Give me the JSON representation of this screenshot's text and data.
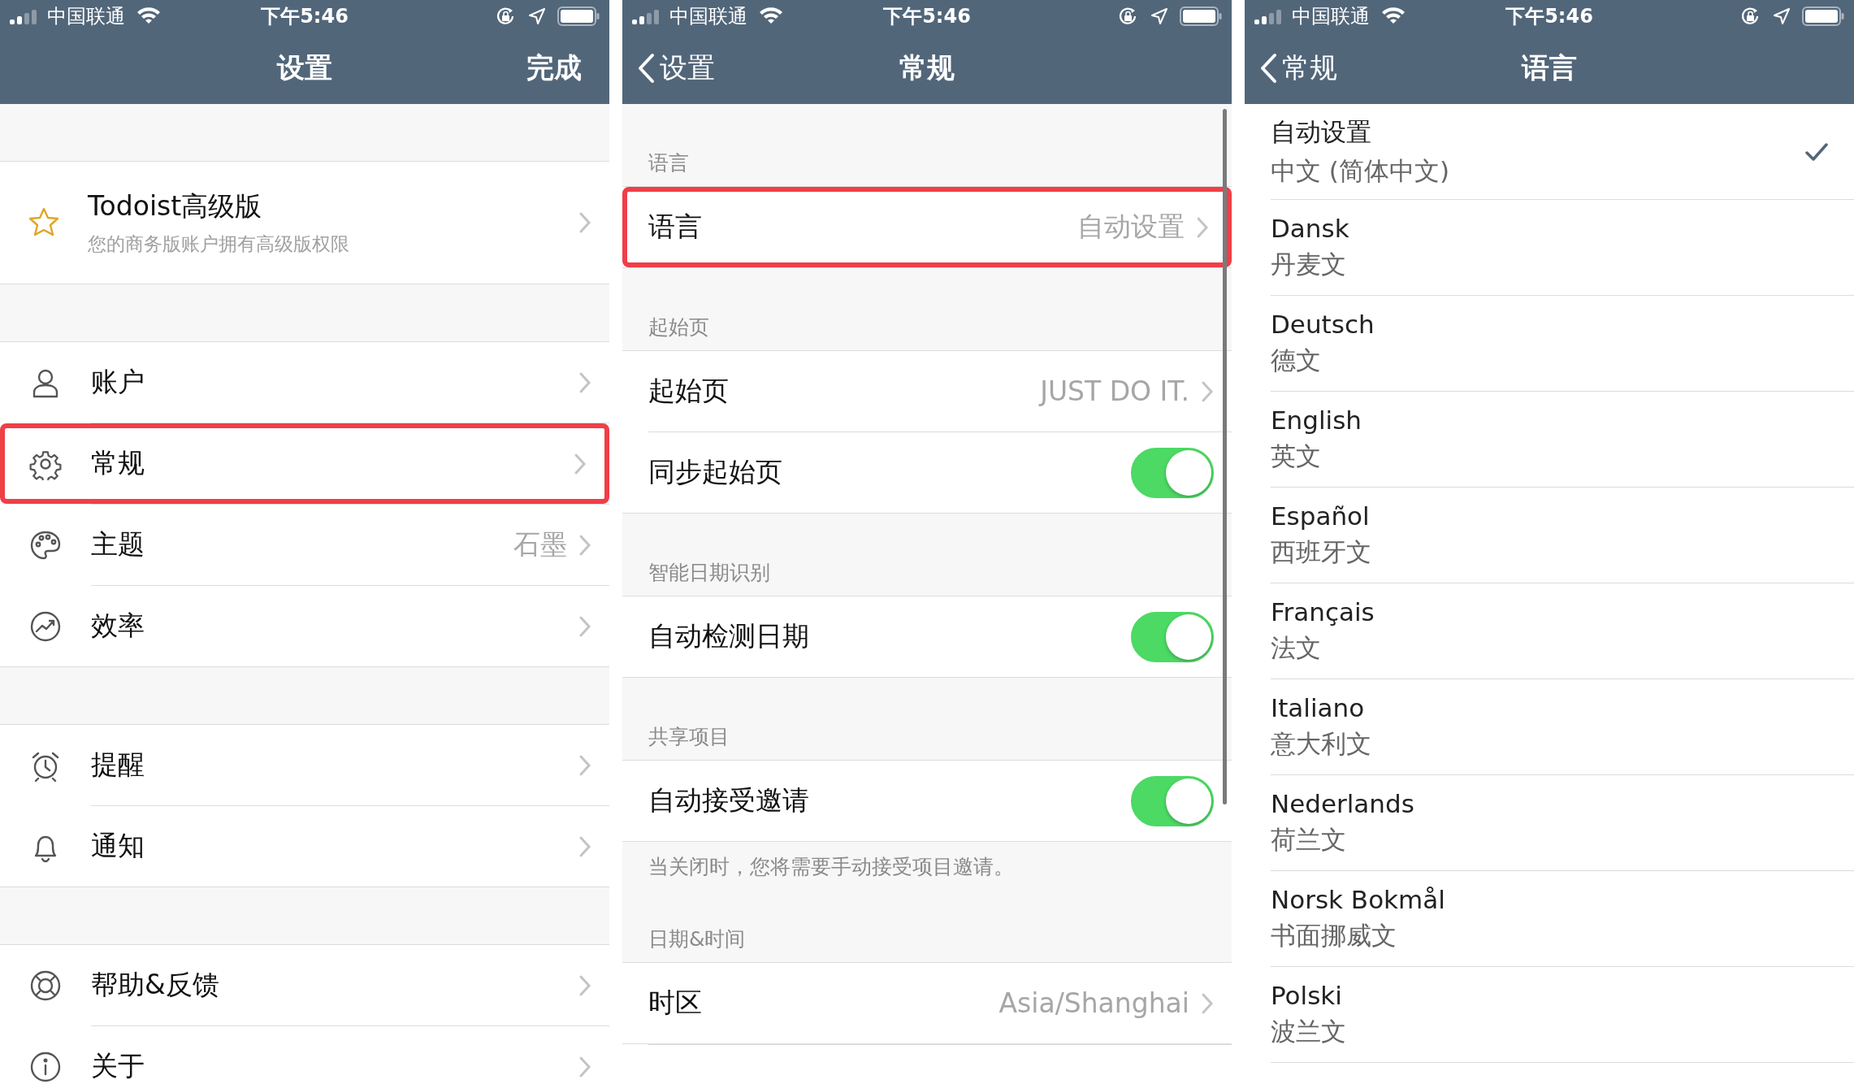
{
  "screens": [
    {
      "kind": "settings",
      "status_bar": {
        "carrier": "中国联通",
        "time": "下午5:46"
      },
      "nav": {
        "title": "设置",
        "action": "完成"
      },
      "premium": {
        "title": "Todoist高级版",
        "subtitle": "您的商务版账户拥有高级版权限"
      },
      "groups": [
        [
          {
            "label": "账户",
            "highlighted": false
          },
          {
            "label": "常规",
            "highlighted": true
          },
          {
            "label": "主题",
            "value": "石墨",
            "highlighted": false
          },
          {
            "label": "效率",
            "highlighted": false
          }
        ],
        [
          {
            "label": "提醒",
            "highlighted": false
          },
          {
            "label": "通知",
            "highlighted": false
          }
        ],
        [
          {
            "label": "帮助&反馈",
            "highlighted": false
          },
          {
            "label": "关于",
            "highlighted": false
          }
        ]
      ]
    },
    {
      "kind": "general",
      "status_bar": {
        "carrier": "中国联通",
        "time": "下午5:46"
      },
      "nav": {
        "title": "常规",
        "back": "设置"
      },
      "sections": [
        {
          "header": "语言",
          "rows": [
            {
              "kind": "value",
              "label": "语言",
              "value": "自动设置",
              "highlighted": true
            }
          ]
        },
        {
          "header": "起始页",
          "rows": [
            {
              "kind": "value",
              "label": "起始页",
              "value": "JUST DO IT.",
              "highlighted": false
            },
            {
              "kind": "toggle",
              "label": "同步起始页",
              "on": true,
              "highlighted": false
            }
          ]
        },
        {
          "header": "智能日期识别",
          "rows": [
            {
              "kind": "toggle",
              "label": "自动检测日期",
              "on": true,
              "highlighted": false
            }
          ]
        },
        {
          "header": "共享项目",
          "rows": [
            {
              "kind": "toggle",
              "label": "自动接受邀请",
              "on": true,
              "highlighted": false
            }
          ],
          "footer": "当关闭时，您将需要手动接受项目邀请。"
        },
        {
          "header": "日期&时间",
          "rows": [
            {
              "kind": "value",
              "label": "时区",
              "value": "Asia/Shanghai",
              "highlighted": false
            }
          ]
        }
      ]
    },
    {
      "kind": "language",
      "status_bar": {
        "carrier": "中国联通",
        "time": "下午5:46"
      },
      "nav": {
        "title": "语言",
        "back": "常规"
      },
      "languages": [
        {
          "name": "自动设置",
          "native": "中文 (简体中文)",
          "selected": true
        },
        {
          "name": "Dansk",
          "native": "丹麦文",
          "selected": false
        },
        {
          "name": "Deutsch",
          "native": "德文",
          "selected": false
        },
        {
          "name": "English",
          "native": "英文",
          "selected": false
        },
        {
          "name": "Español",
          "native": "西班牙文",
          "selected": false
        },
        {
          "name": "Français",
          "native": "法文",
          "selected": false
        },
        {
          "name": "Italiano",
          "native": "意大利文",
          "selected": false
        },
        {
          "name": "Nederlands",
          "native": "荷兰文",
          "selected": false
        },
        {
          "name": "Norsk Bokmål",
          "native": "书面挪威文",
          "selected": false
        },
        {
          "name": "Polski",
          "native": "波兰文",
          "selected": false
        }
      ]
    }
  ]
}
